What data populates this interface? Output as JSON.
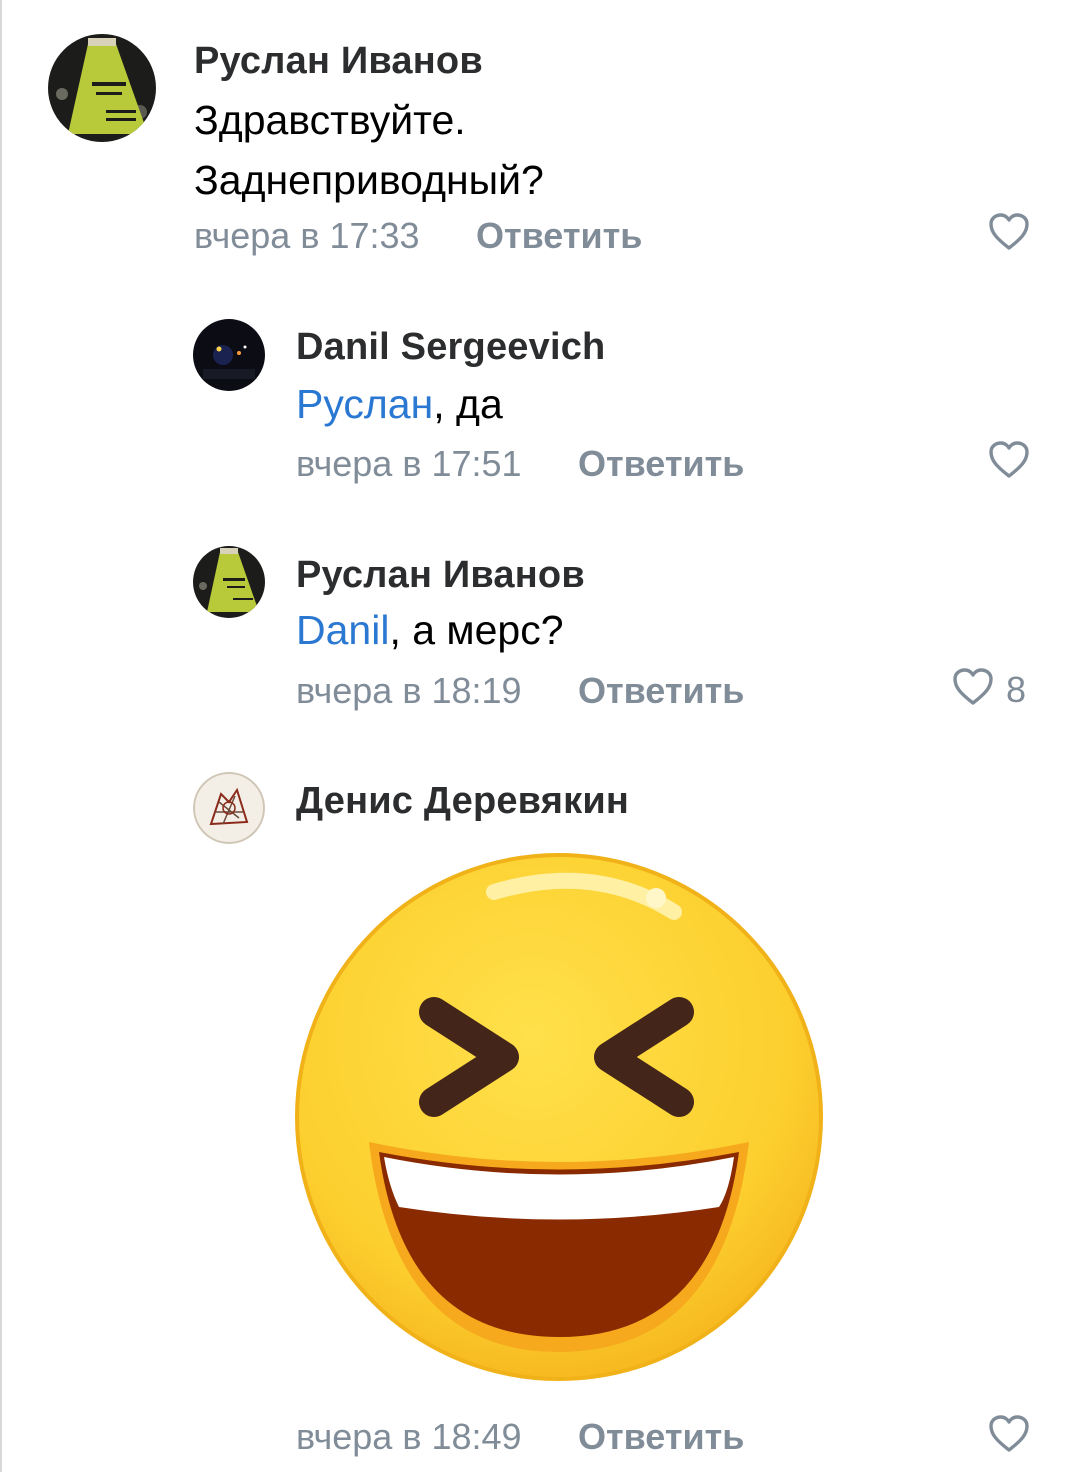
{
  "comments": [
    {
      "author": "Руслан Иванов",
      "text_lines": [
        "Здравствуйте.",
        "Заднеприводный?"
      ],
      "time": "вчера в 17:33",
      "reply_label": "Ответить",
      "likes": ""
    },
    {
      "author": "Danil Sergeevich",
      "mention": "Руслан",
      "text": ", да",
      "time": "вчера в 17:51",
      "reply_label": "Ответить",
      "likes": ""
    },
    {
      "author": "Руслан Иванов",
      "mention": "Danil",
      "text": ", а мерс?",
      "time": "вчера в 18:19",
      "reply_label": "Ответить",
      "likes": "8"
    },
    {
      "author": "Денис Деревякин",
      "sticker": "laughing-face-sticker",
      "time": "вчера в 18:49",
      "reply_label": "Ответить",
      "likes": ""
    }
  ],
  "colors": {
    "author": "#2c2d2e",
    "mention": "#2a78d2",
    "meta": "#818c99",
    "sticker_yellow": "#fccf2e"
  },
  "icons": [
    "heart-outline-icon"
  ]
}
